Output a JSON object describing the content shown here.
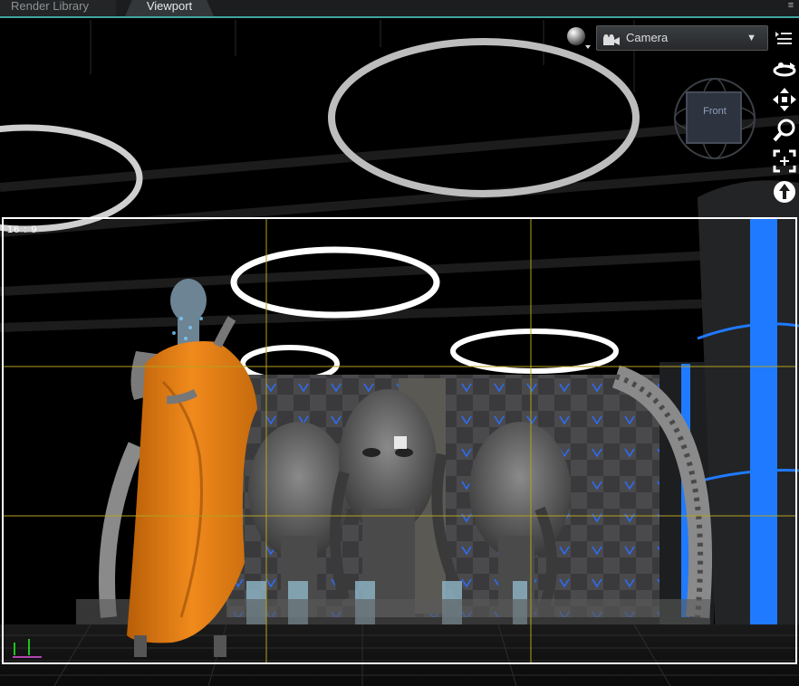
{
  "tabs": {
    "render_library": "Render Library",
    "viewport": "Viewport",
    "menu_icon": "menu-lines-icon"
  },
  "toolbar": {
    "shading_icon": "shading-sphere-icon",
    "camera_select_value": "Camera",
    "camera_icon": "camera-icon",
    "dropdown_icon": "chevron-down-icon",
    "layout_icon": "layout-list-icon"
  },
  "navigation": {
    "cube_face": "Front",
    "tools": [
      "orbit-icon",
      "pan-move-icon",
      "zoom-icon",
      "frame-icon",
      "reset-up-icon"
    ]
  },
  "overlay": {
    "aspect_ratio": "16 : 9",
    "frame_color": "#ffffff",
    "guide_color": "#b5a11f"
  },
  "scene": {
    "robe_color": "#e07a12",
    "accent_blue": "#1f7aff",
    "ring_color": "#e6e6e6"
  }
}
